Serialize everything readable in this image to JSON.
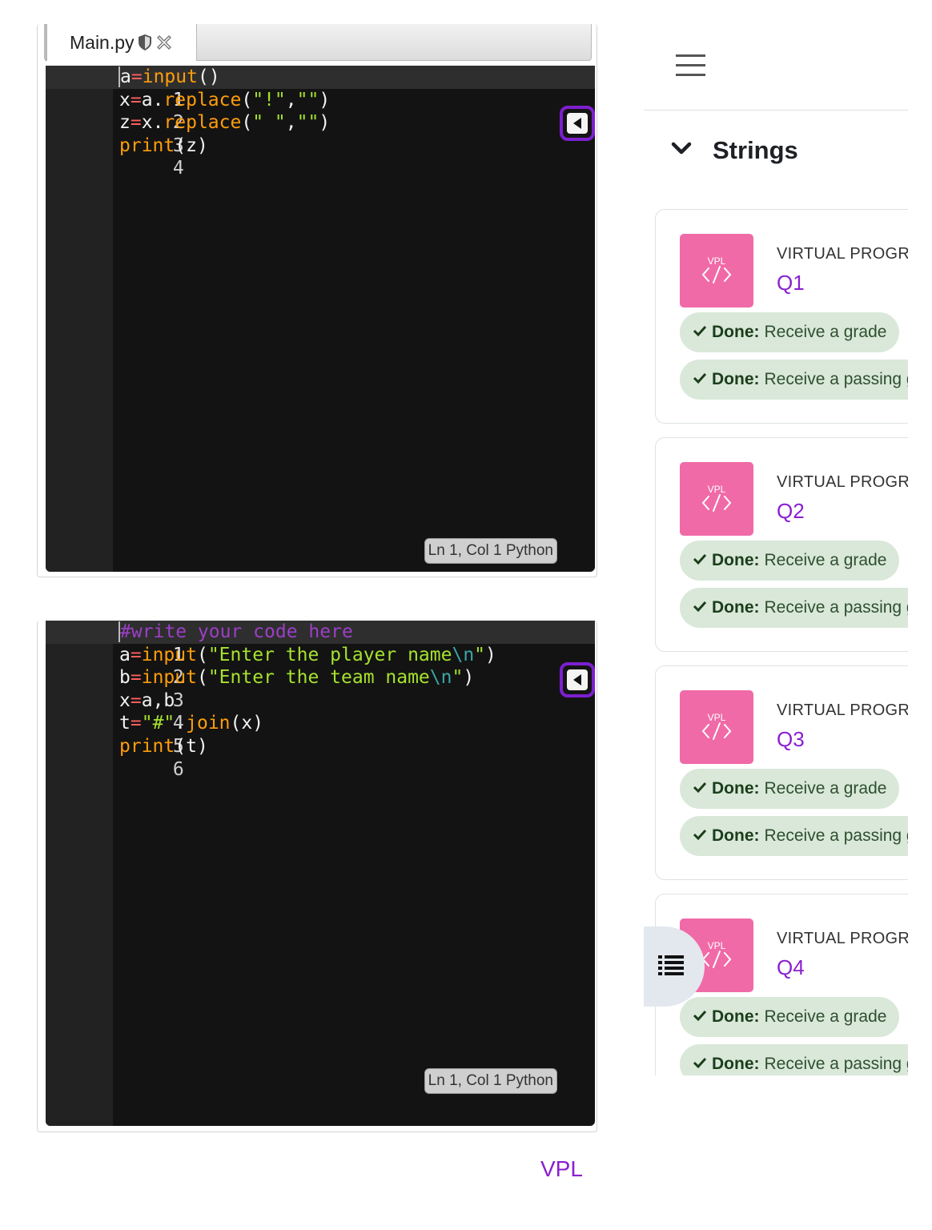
{
  "editor1": {
    "tab_label": "Main.py",
    "lines": [
      "1",
      "2",
      "3",
      "4"
    ],
    "status": "Ln 1, Col 1 Python"
  },
  "editor2": {
    "lines": [
      "1",
      "2",
      "3",
      "4",
      "5",
      "6"
    ],
    "status": "Ln 1, Col 1 Python"
  },
  "footer": {
    "vpl_link": "VPL"
  },
  "sidebar": {
    "section_title": "Strings",
    "icon_text": "VPL",
    "activities": [
      {
        "type": "VIRTUAL PROGRAMMING LAB",
        "name": "Q1",
        "done_label": "Done:",
        "req1": "Receive a grade",
        "req2": "Receive a passing grade"
      },
      {
        "type": "VIRTUAL PROGRAMMING LAB",
        "name": "Q2",
        "done_label": "Done:",
        "req1": "Receive a grade",
        "req2": "Receive a passing grade"
      },
      {
        "type": "VIRTUAL PROGRAMMING LAB",
        "name": "Q3",
        "done_label": "Done:",
        "req1": "Receive a grade",
        "req2": "Receive a passing grade"
      },
      {
        "type": "VIRTUAL PROGRAMMING LAB",
        "name": "Q4",
        "done_label": "Done:",
        "req1": "Receive a grade",
        "req2": "Receive a passing grade"
      }
    ]
  },
  "colors": {
    "accent": "#8a1fd0",
    "vpl_icon": "#f06aa7",
    "badge_bg": "#d9e8d9",
    "editor_bg": "#131313"
  },
  "icons": {
    "menu": "hamburger-icon",
    "section": "chevron-down-icon",
    "done": "check-icon",
    "tab": "shield-icon",
    "close_tab": "close-icon",
    "collapse": "collapse-panel-icon",
    "index": "list-icon"
  }
}
